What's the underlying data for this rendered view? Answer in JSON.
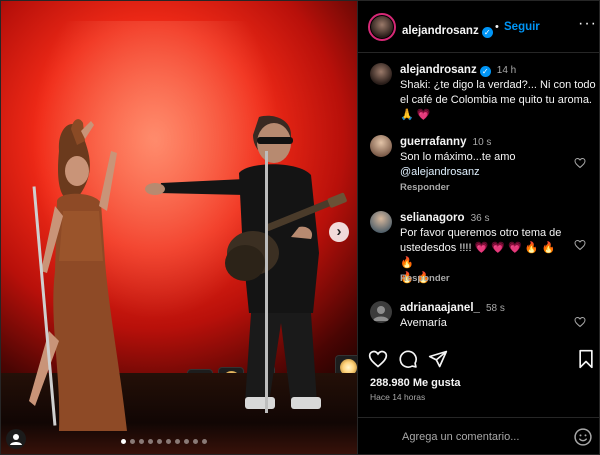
{
  "header": {
    "username": "alejandrosanz",
    "separator": "•",
    "follow_label": "Seguir",
    "more_label": "···"
  },
  "caption": {
    "username": "alejandrosanz",
    "time": "14 h",
    "text": "Shaki: ¿te digo la verdad?... Ni con todo el café de Colombia me quito tu aroma.",
    "emojis": "🙏 💗"
  },
  "comments": [
    {
      "username": "guerrafanny",
      "time": "10 s",
      "text": "Son lo máximo...te amo",
      "mention": "@alejandrosanz",
      "reply_label": "Responder"
    },
    {
      "username": "selianagoro",
      "time": "36 s",
      "text": "Por favor queremos otro tema de ustedesdos !!!! 💗 💗 💗 🔥 🔥 🔥",
      "emojis2": "🔥 🔥",
      "reply_label": "Responder"
    },
    {
      "username": "adrianaajanel_",
      "time": "58 s",
      "text": "Avemaría"
    }
  ],
  "actions": {
    "like_icon": "heart-outline-icon",
    "comment_icon": "comment-icon",
    "share_icon": "paper-plane-icon",
    "save_icon": "bookmark-icon"
  },
  "likes_text": "288.980 Me gusta",
  "time_ago": "Hace 14 horas",
  "comment_input": {
    "placeholder": "Agrega un comentario..."
  },
  "carousel": {
    "next_label": "›",
    "dots_total": 10,
    "active_dot": 1
  },
  "colors": {
    "accent_blue": "#0095f6",
    "background": "#000000",
    "stage_red": "#f02a17",
    "heart_emoji": "#ff3ea5"
  }
}
